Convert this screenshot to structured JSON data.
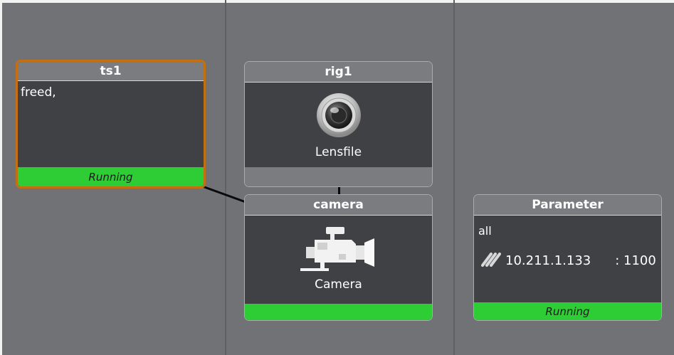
{
  "nodes": {
    "ts1": {
      "title": "ts1",
      "body_text": "freed,",
      "status": "Running"
    },
    "rig1": {
      "title": "rig1",
      "icon": "lens-icon",
      "label": "Lensfile"
    },
    "camera": {
      "title": "camera",
      "icon": "video-camera-icon",
      "label": "Camera"
    },
    "parameter": {
      "title": "Parameter",
      "body_text": "all",
      "network_icon": "network-link-icon",
      "ip": "10.211.1.133",
      "port": ": 1100",
      "status": "Running"
    }
  },
  "colors": {
    "canvas": "#707276",
    "node_body": "#3f4144",
    "node_header": "#7a7c7f",
    "status_running": "#2ecc35",
    "selected_border": "#c46f12"
  }
}
